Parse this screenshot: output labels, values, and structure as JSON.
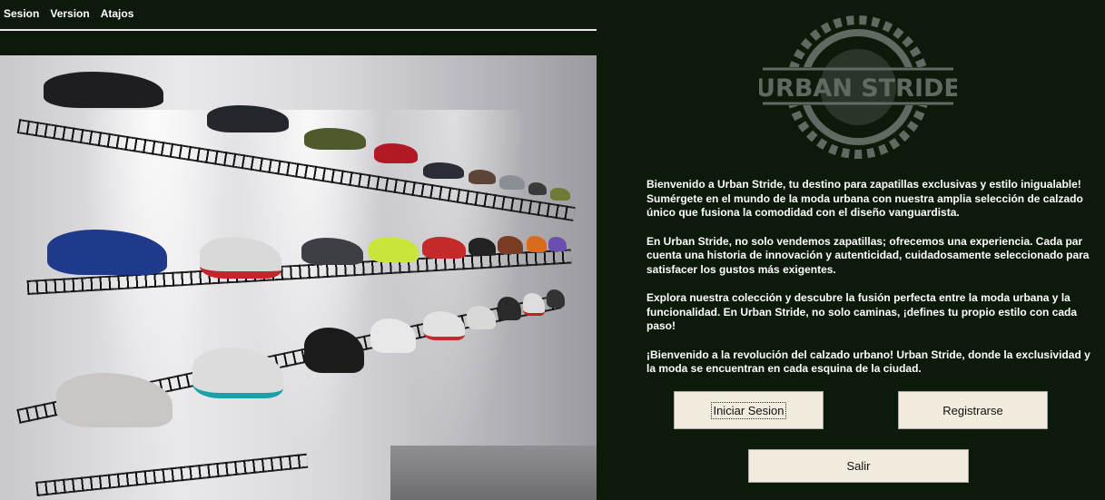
{
  "menu": {
    "items": [
      "Sesion",
      "Version",
      "Atajos"
    ]
  },
  "logo": {
    "text": "URBAN STRIDE"
  },
  "welcome": {
    "paragraphs": [
      "Bienvenido a Urban Stride, tu destino para zapatillas exclusivas y estilo inigualable! Sumérgete en el mundo de la moda urbana con nuestra amplia selección de calzado único que fusiona la comodidad con el diseño vanguardista.",
      "En Urban Stride, no solo vendemos zapatillas; ofrecemos una experiencia. Cada par cuenta una historia de innovación y autenticidad, cuidadosamente seleccionado para satisfacer los gustos más exigentes.",
      "Explora nuestra colección y descubre la fusión perfecta entre la moda urbana y la funcionalidad. En Urban Stride, no solo caminas, ¡defines tu propio estilo con cada paso!",
      "¡Bienvenido a la revolución del calzado urbano! Urban Stride, donde la exclusividad y la moda se encuentran en cada esquina de la ciudad."
    ]
  },
  "buttons": {
    "login": "Iniciar Sesion",
    "register": "Registrarse",
    "exit": "Salir"
  },
  "colors": {
    "background": "#0c1a09",
    "button": "#f2ecde",
    "logo": "#5e6b63"
  },
  "image": {
    "description_icon": "sneaker-wall-photo"
  }
}
